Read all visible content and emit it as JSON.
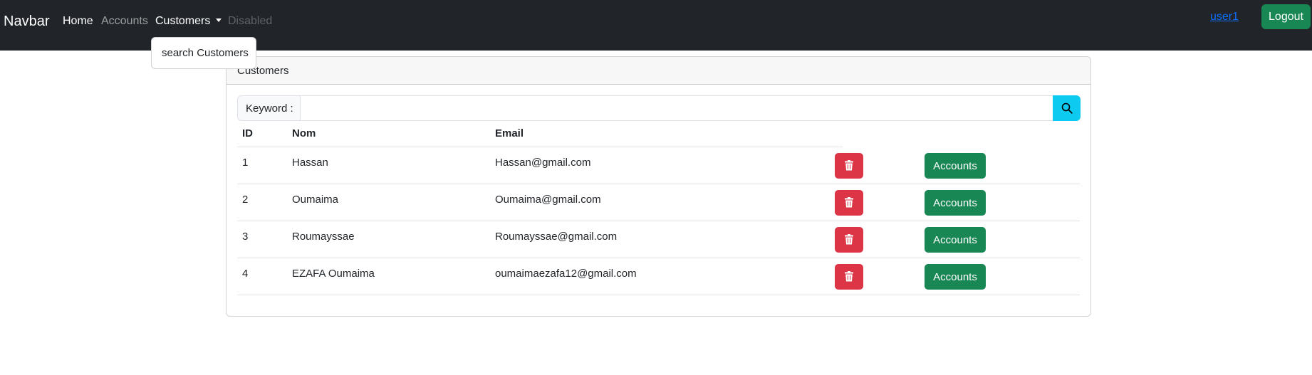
{
  "navbar": {
    "brand": "Navbar",
    "links": {
      "home": "Home",
      "accounts": "Accounts",
      "customers": "Customers",
      "disabled": "Disabled"
    },
    "user": "user1",
    "logout": "Logout"
  },
  "dropdown": {
    "items": [
      "search Customers"
    ]
  },
  "card": {
    "title": "Customers",
    "search": {
      "label": "Keyword :",
      "value": "",
      "placeholder": "",
      "button_icon": "search-icon"
    },
    "table": {
      "headers": {
        "id": "ID",
        "nom": "Nom",
        "email": "Email"
      },
      "rows": [
        {
          "id": "1",
          "nom": "Hassan",
          "email": "Hassan@gmail.com",
          "action": "Accounts"
        },
        {
          "id": "2",
          "nom": "Oumaima",
          "email": "Oumaima@gmail.com",
          "action": "Accounts"
        },
        {
          "id": "3",
          "nom": "Roumayssae",
          "email": "Roumayssae@gmail.com",
          "action": "Accounts"
        },
        {
          "id": "4",
          "nom": "EZAFA Oumaima",
          "email": "oumaimaezafa12@gmail.com",
          "action": "Accounts"
        }
      ]
    }
  },
  "colors": {
    "navbar_bg": "#212529",
    "danger": "#dc3545",
    "success": "#198754",
    "info": "#0dcaf0",
    "link": "#0d6efd"
  }
}
